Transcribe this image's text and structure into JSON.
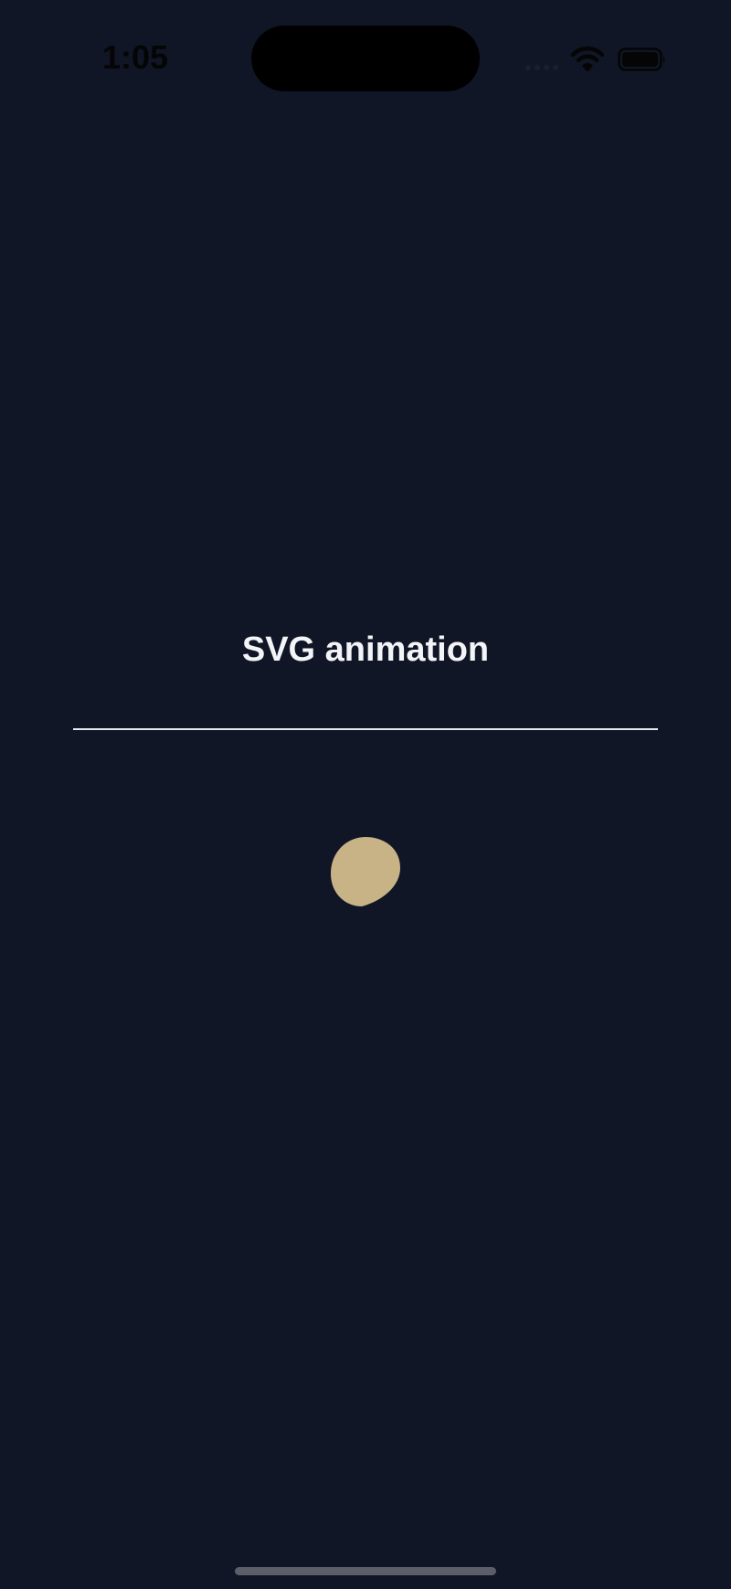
{
  "status_bar": {
    "time": "1:05",
    "icons": [
      "signal-icon",
      "wifi-icon",
      "battery-icon"
    ]
  },
  "main": {
    "title": "SVG animation"
  },
  "colors": {
    "background": "#101626",
    "title": "#f3f4f7",
    "divider": "#e8e9ee",
    "blob": "#c8b387",
    "home_indicator": "#5c5f6a"
  }
}
